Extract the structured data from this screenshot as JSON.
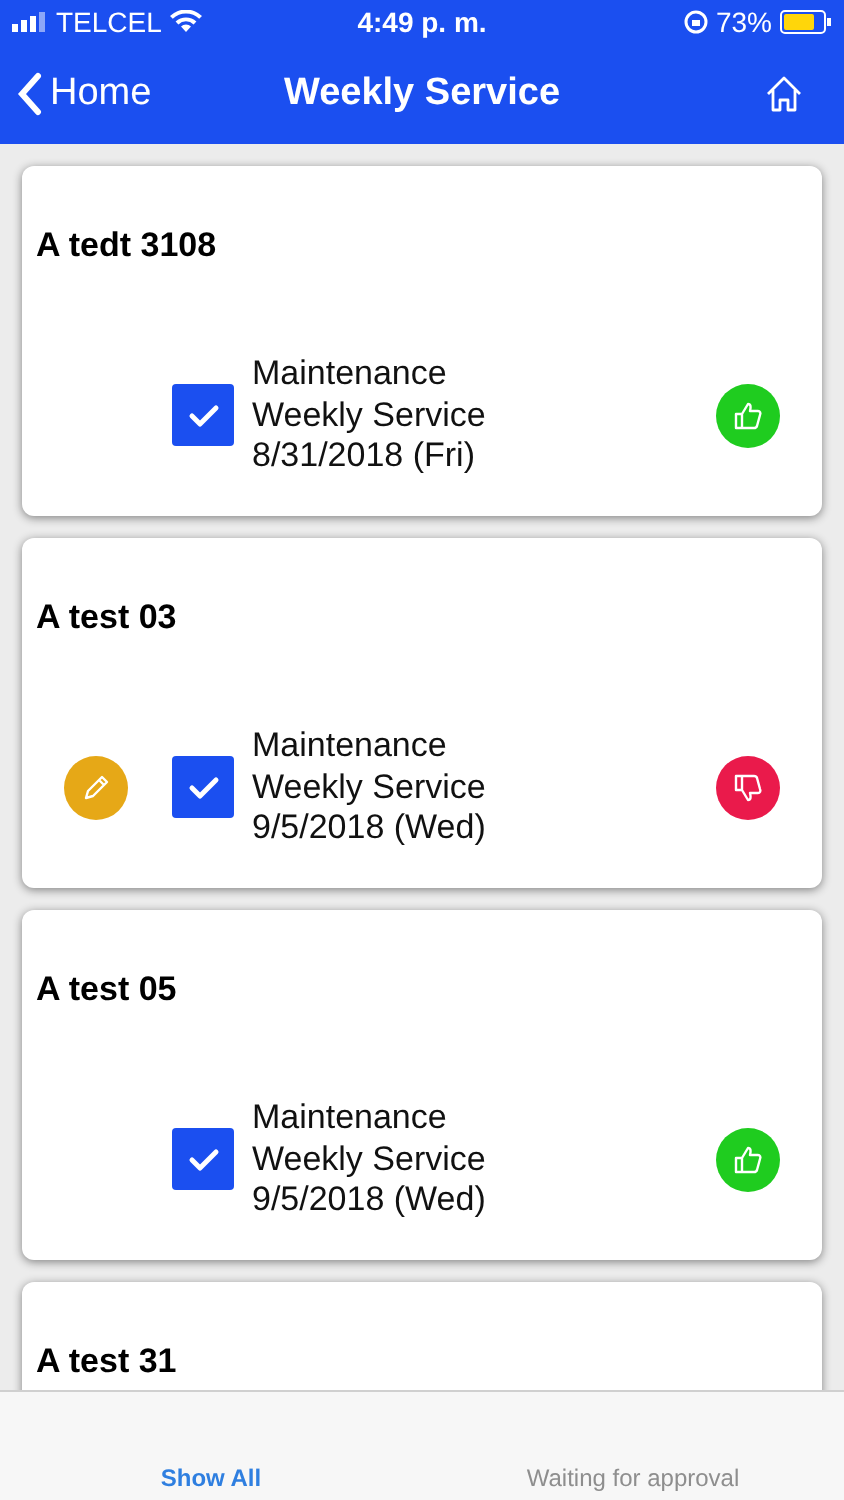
{
  "status_bar": {
    "carrier": "TELCEL",
    "time": "4:49 p. m.",
    "battery": "73%"
  },
  "nav": {
    "back": "Home",
    "title": "Weekly Service"
  },
  "services": [
    {
      "title": "A tedt 3108",
      "checked": true,
      "editable": false,
      "approved": true,
      "lines": [
        "Maintenance",
        "Weekly Service",
        "8/31/2018 (Fri)"
      ]
    },
    {
      "title": "A test 03",
      "checked": true,
      "editable": true,
      "approved": false,
      "lines": [
        "Maintenance",
        "Weekly Service",
        "9/5/2018 (Wed)"
      ]
    },
    {
      "title": "A test 05",
      "checked": true,
      "editable": false,
      "approved": true,
      "lines": [
        "Maintenance",
        "Weekly Service",
        "9/5/2018 (Wed)"
      ]
    },
    {
      "title": "A test 31"
    }
  ],
  "tabs": [
    {
      "label": "Show All",
      "selected": true
    },
    {
      "label": "Waiting for approval",
      "selected": false
    }
  ]
}
